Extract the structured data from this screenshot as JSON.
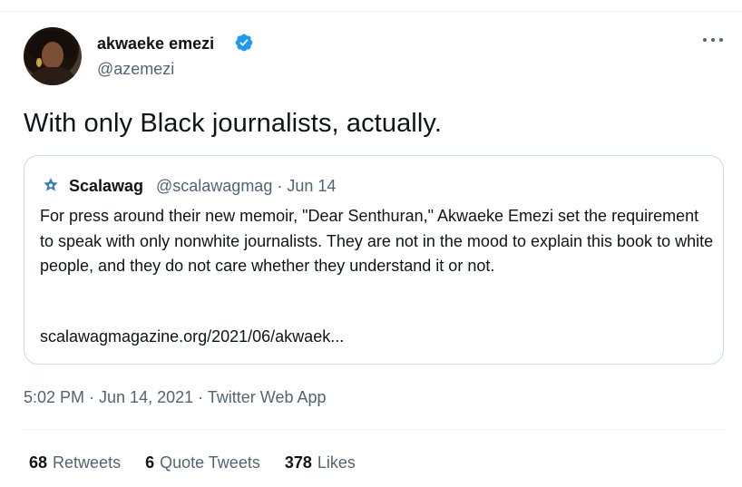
{
  "author": {
    "display_name": "akwaeke emezi",
    "handle": "@azemezi",
    "verified": true,
    "avatar_icon": "profile-photo"
  },
  "tweet": {
    "text": "With only Black journalists, actually."
  },
  "quoted_tweet": {
    "name": "Scalawag",
    "handle_date": "@scalawagmag · Jun 14",
    "body": "For press around their new memoir, \"Dear Senthuran,\" Akwaeke Emezi set the requirement to speak with only nonwhite journalists. They are not in the mood to explain this book to white people, and they do not care whether they understand it or not.",
    "link": "scalawagmagazine.org/2021/06/akwaek..."
  },
  "meta": {
    "timestamp_source": "5:02 PM · Jun 14, 2021 · Twitter Web App"
  },
  "stats": {
    "retweets_count": "68",
    "retweets_label": "Retweets",
    "quotes_count": "6",
    "quotes_label": "Quote Tweets",
    "likes_count": "378",
    "likes_label": "Likes"
  },
  "colors": {
    "verified_blue": "#1d9bf0",
    "secondary_text": "#536471",
    "primary_text": "#0f1419",
    "border": "#cfd9de"
  }
}
